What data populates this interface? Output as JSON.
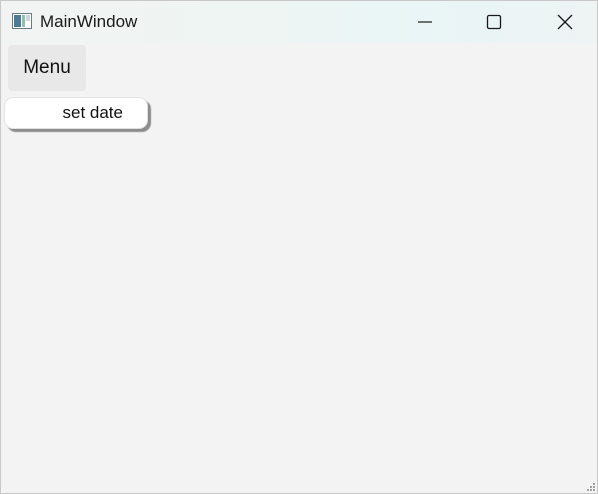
{
  "window": {
    "title": "MainWindow",
    "app_icon": "app-window-icon",
    "controls": {
      "minimize": "minimize-icon",
      "maximize": "maximize-icon",
      "close": "close-icon"
    }
  },
  "toolbar": {
    "menu_label": "Menu"
  },
  "main": {
    "set_date_label": "set date"
  },
  "colors": {
    "background": "#f3f3f3",
    "button_bg": "#ffffff",
    "menu_bg": "#e8e8e8"
  }
}
